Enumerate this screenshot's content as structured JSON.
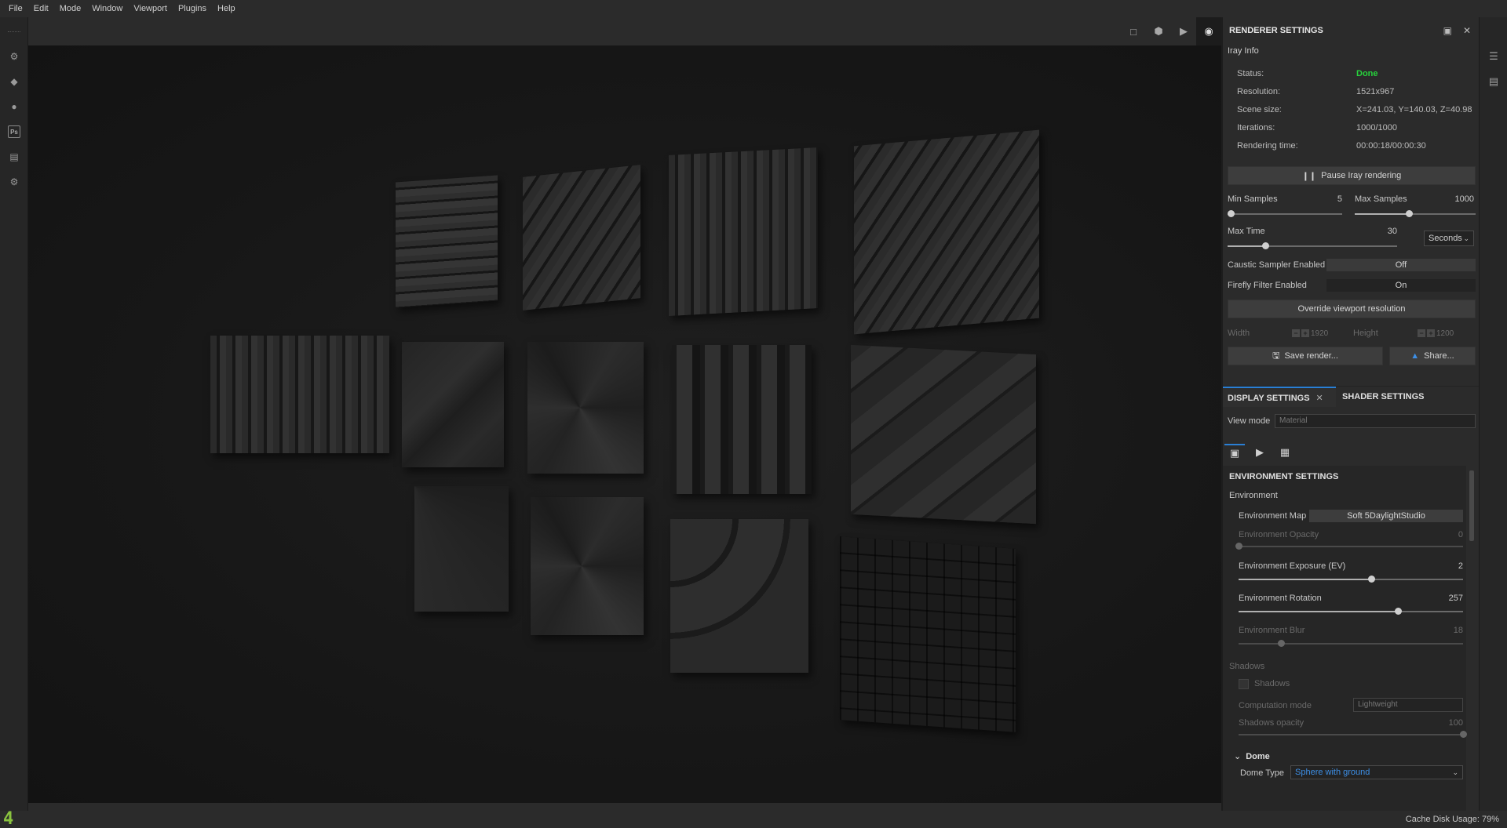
{
  "menu": [
    "File",
    "Edit",
    "Mode",
    "Window",
    "Viewport",
    "Plugins",
    "Help"
  ],
  "renderer": {
    "title": "RENDERER SETTINGS",
    "info_section": "Iray Info",
    "info": [
      {
        "key": "Status:",
        "value": "Done"
      },
      {
        "key": "Resolution:",
        "value": "1521x967"
      },
      {
        "key": "Scene size:",
        "value": "X=241.03, Y=140.03, Z=40.98"
      },
      {
        "key": "Iterations:",
        "value": "1000/1000"
      },
      {
        "key": "Rendering time:",
        "value": "00:00:18/00:00:30"
      }
    ],
    "pause_button": "Pause Iray rendering",
    "min_samples": {
      "label": "Min Samples",
      "value": "5",
      "level": 0.03
    },
    "max_samples": {
      "label": "Max Samples",
      "value": "1000",
      "level": 0.45
    },
    "max_time": {
      "label": "Max Time",
      "value": "30",
      "level": 0.22,
      "unit": "Seconds"
    },
    "caustic": {
      "label": "Caustic Sampler Enabled",
      "value": "Off"
    },
    "firefly": {
      "label": "Firefly Filter Enabled",
      "value": "On"
    },
    "override_button": "Override viewport resolution",
    "width_label": "Width",
    "width_value": "1920",
    "height_label": "Height",
    "height_value": "1200",
    "save_button": "Save render...",
    "share_button": "Share..."
  },
  "tabs": {
    "display": "DISPLAY SETTINGS",
    "shader": "SHADER SETTINGS"
  },
  "view_mode": {
    "label": "View mode",
    "placeholder": "Material"
  },
  "environment": {
    "title": "ENVIRONMENT SETTINGS",
    "group": "Environment",
    "map_label": "Environment Map",
    "map_value": "Soft 5DaylightStudio",
    "opacity": {
      "label": "Environment Opacity",
      "value": "0",
      "level": 0.0
    },
    "exposure": {
      "label": "Environment Exposure (EV)",
      "value": "2",
      "level": 0.59
    },
    "rotation": {
      "label": "Environment Rotation",
      "value": "257",
      "level": 0.71
    },
    "blur": {
      "label": "Environment Blur",
      "value": "18",
      "level": 0.19
    },
    "shadows_group": "Shadows",
    "shadows_checkbox": "Shadows",
    "computation_label": "Computation mode",
    "computation_value": "Lightweight",
    "shadows_opacity": {
      "label": "Shadows opacity",
      "value": "100",
      "level": 1.0
    },
    "dome_header": "Dome",
    "dome_type_label": "Dome Type",
    "dome_type_value": "Sphere with ground"
  },
  "status": {
    "logo": "4",
    "cache": "Cache Disk Usage:   79%"
  },
  "colors": {
    "accent": "#2a7fd4",
    "done": "#27d13c",
    "logo": "#8ac43f"
  }
}
